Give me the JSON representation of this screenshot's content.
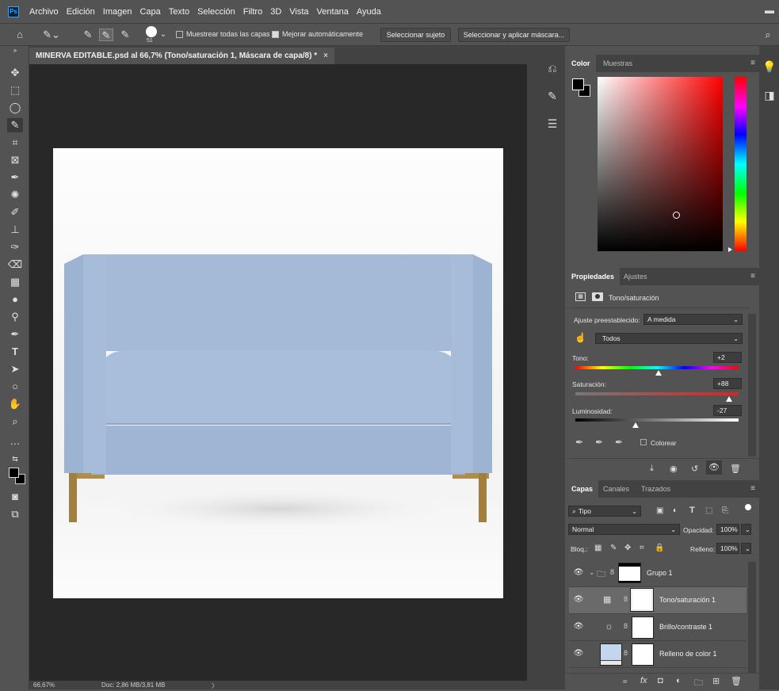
{
  "menubar": {
    "logo": "Ps",
    "items": [
      "Archivo",
      "Edición",
      "Imagen",
      "Capa",
      "Texto",
      "Selección",
      "Filtro",
      "3D",
      "Vista",
      "Ventana",
      "Ayuda"
    ]
  },
  "options": {
    "brush_size": "51",
    "sample_all_label": "Muestrear todas las capas",
    "sample_all_checked": false,
    "auto_enhance_label": "Mejorar automáticamente",
    "auto_enhance_checked": true,
    "select_subject_label": "Seleccionar sujeto",
    "select_mask_label": "Seleccionar y aplicar máscara..."
  },
  "document": {
    "tab_title": "MINERVA EDITABLE.psd al 66,7% (Tono/saturación 1, Máscara de capa/8) *",
    "close": "×"
  },
  "status": {
    "zoom": "66,67%",
    "doc_info": "Doc: 2,86 MB/3,81 MB",
    "arrow": "〉"
  },
  "color_panel": {
    "tabs": [
      "Color",
      "Muestras"
    ],
    "accent_hue": "#ff0000"
  },
  "properties_panel": {
    "tabs": [
      "Propiedades",
      "Ajustes"
    ],
    "layer_type": "Tono/saturación",
    "preset_label": "Ajuste preestablecido:",
    "preset_value": "A medida",
    "channel_value": "Todos",
    "hue_label": "Tono:",
    "hue_value": "+2",
    "hue_fraction": 0.51,
    "saturation_label": "Saturación:",
    "saturation_value": "+88",
    "saturation_fraction": 0.94,
    "lightness_label": "Luminosidad:",
    "lightness_value": "-27",
    "lightness_fraction": 0.37,
    "colorize_label": "Colorear"
  },
  "layers_panel": {
    "tabs": [
      "Capas",
      "Canales",
      "Trazados"
    ],
    "filter_value": "Tipo",
    "blend_mode": "Normal",
    "opacity_label": "Opacidad:",
    "opacity_value": "100%",
    "lock_label": "Bloq.:",
    "fill_label": "Relleno:",
    "fill_value": "100%",
    "layers": [
      {
        "name": "Grupo 1"
      },
      {
        "name": "Tono/saturación 1"
      },
      {
        "name": "Brillo/contraste 1"
      },
      {
        "name": "Relleno de color 1"
      }
    ]
  },
  "colors": {
    "sofa": "#a7bcd9",
    "legs": "#b08d4a"
  }
}
